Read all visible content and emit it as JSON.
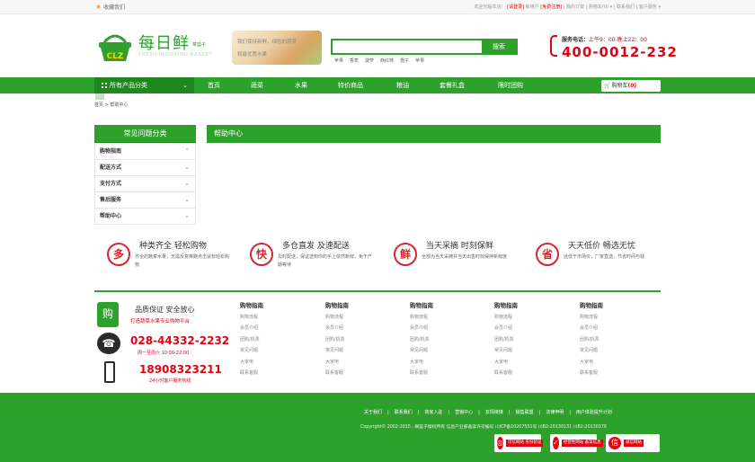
{
  "topbar": {
    "favorite": "收藏我们",
    "welcome": "欢迎光临本店！",
    "login": "[请登录]",
    "new_user": "新用户",
    "register": "[免费注册]",
    "my_orders": "我的订单",
    "cart": "购物车(0)",
    "contact": "联系我们",
    "service": "客户服务"
  },
  "header": {
    "brand": "每日鲜",
    "brand_sub": "菜篮子",
    "brand_en": "FRESH SHOPPING BASKET",
    "logo_badge": "CLZ",
    "slogan1": "我们保持新鲜，绿色的蔬菜",
    "slogan2": "和最优质水果",
    "search_placeholder": "",
    "search_button": "搜索",
    "hot_words": [
      "苹果",
      "香蕉",
      "菠萝",
      "西红柿",
      "橙子",
      "苹果"
    ],
    "service_label": "服务电话：",
    "service_hours": "上午9：00-晚上22：00",
    "hotline": "400-0012-232"
  },
  "nav": {
    "all_categories": "所有产品分类",
    "items": [
      "首页",
      "蔬菜",
      "水果",
      "特价商品",
      "粮油",
      "套餐礼盒",
      "限时团购"
    ],
    "cart_label": "购物车",
    "cart_count": "(0)"
  },
  "breadcrumb": "首页 > 帮助中心",
  "sidebar": {
    "title": "常见问题分类",
    "items": [
      "购物指南",
      "配送方式",
      "支付方式",
      "售后服务",
      "帮助中心"
    ]
  },
  "main": {
    "title": "帮助中心"
  },
  "features": [
    {
      "icon": "多",
      "title": "种类齐全 轻松购物",
      "desc": "齐全的蔬菜水果，无需反复奔跑点击鼠标轻松购物"
    },
    {
      "icon": "快",
      "title": "多仓直发 及速配送",
      "desc": "及时配送，保证送到你的手上依然新鲜，免于产期等待"
    },
    {
      "icon": "鲜",
      "title": "当天采摘 时刻保鲜",
      "desc": "全部为当天采摘并当天出售时刻保持新鲜度"
    },
    {
      "icon": "省",
      "title": "天天低价 畅选无忧",
      "desc": "远低于市场价，厂家直送，节省时间与钱"
    }
  ],
  "bottom": {
    "quality_icon": "购",
    "quality_title": "品质保证 安全放心",
    "quality_sub": "打造蔬菜水果专业购物平台",
    "tel": "028-44332-2232",
    "tel_hours": "周一至周六 10:00-22:00",
    "mobile": "18908323211",
    "mobile_note": "24小时客户服务热线",
    "columns": [
      {
        "head": "购物指南",
        "links": [
          "购物流程",
          "会员介绍",
          "团购/机票",
          "常见问题",
          "大家电",
          "联系客服"
        ]
      },
      {
        "head": "购物指南",
        "links": [
          "购物流程",
          "会员介绍",
          "团购/机票",
          "常见问题",
          "大家电",
          "联系客服"
        ]
      },
      {
        "head": "购物指南",
        "links": [
          "购物流程",
          "会员介绍",
          "团购/机票",
          "常见问题",
          "大家电",
          "联系客服"
        ]
      },
      {
        "head": "购物指南",
        "links": [
          "购物流程",
          "会员介绍",
          "团购/机票",
          "常见问题",
          "大家电",
          "联系客服"
        ]
      },
      {
        "head": "购物指南",
        "links": [
          "购物流程",
          "会员介绍",
          "团购/机票",
          "常见问题",
          "大家电",
          "联系客服"
        ]
      }
    ]
  },
  "footer": {
    "links": [
      "关于我们",
      "联系我们",
      "商家入驻",
      "营销中心",
      "友情链接",
      "销售联盟",
      "法律申明",
      "用户体验提升计划"
    ],
    "copyright": "Copyright© 2002-2015 , 鲜篮子版权所有 信息产业部备案许可编号 川ICP备10207551号 川B2-20130131 川B2-20130376",
    "badges": [
      {
        "icon": "◎",
        "text": "可信网站 身份验证"
      },
      {
        "icon": "✓",
        "text": "经营性网站 备案信息"
      },
      {
        "icon": "信",
        "text": "诚信网站"
      }
    ]
  },
  "colors": {
    "brand_green": "#2ea02c",
    "accent_red": "#e60012"
  }
}
